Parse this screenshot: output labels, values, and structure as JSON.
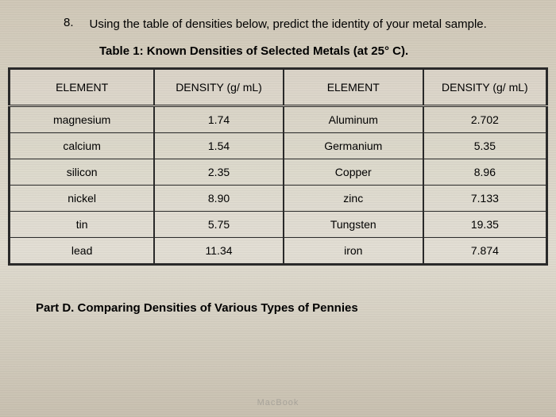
{
  "question": {
    "number": "8.",
    "text": "Using the table of densities below, predict the identity of your metal sample."
  },
  "table": {
    "title_label": "Table 1:",
    "title_text": "Known Densities of Selected Metals (at 25° C).",
    "headers": {
      "col1": "ELEMENT",
      "col2": "DENSITY (g/ mL)",
      "col3": "ELEMENT",
      "col4": "DENSITY (g/ mL)"
    },
    "chart_data": {
      "type": "table",
      "rows": [
        {
          "element1": "magnesium",
          "density1": "1.74",
          "element2": "Aluminum",
          "density2": "2.702"
        },
        {
          "element1": "calcium",
          "density1": "1.54",
          "element2": "Germanium",
          "density2": "5.35"
        },
        {
          "element1": "silicon",
          "density1": "2.35",
          "element2": "Copper",
          "density2": "8.96"
        },
        {
          "element1": "nickel",
          "density1": "8.90",
          "element2": "zinc",
          "density2": "7.133"
        },
        {
          "element1": "tin",
          "density1": "5.75",
          "element2": "Tungsten",
          "density2": "19.35"
        },
        {
          "element1": "lead",
          "density1": "11.34",
          "element2": "iron",
          "density2": "7.874"
        }
      ]
    }
  },
  "part_d": {
    "label": "Part D.",
    "title": "Comparing Densities of Various Types of Pennies"
  },
  "device_label": "MacBook"
}
